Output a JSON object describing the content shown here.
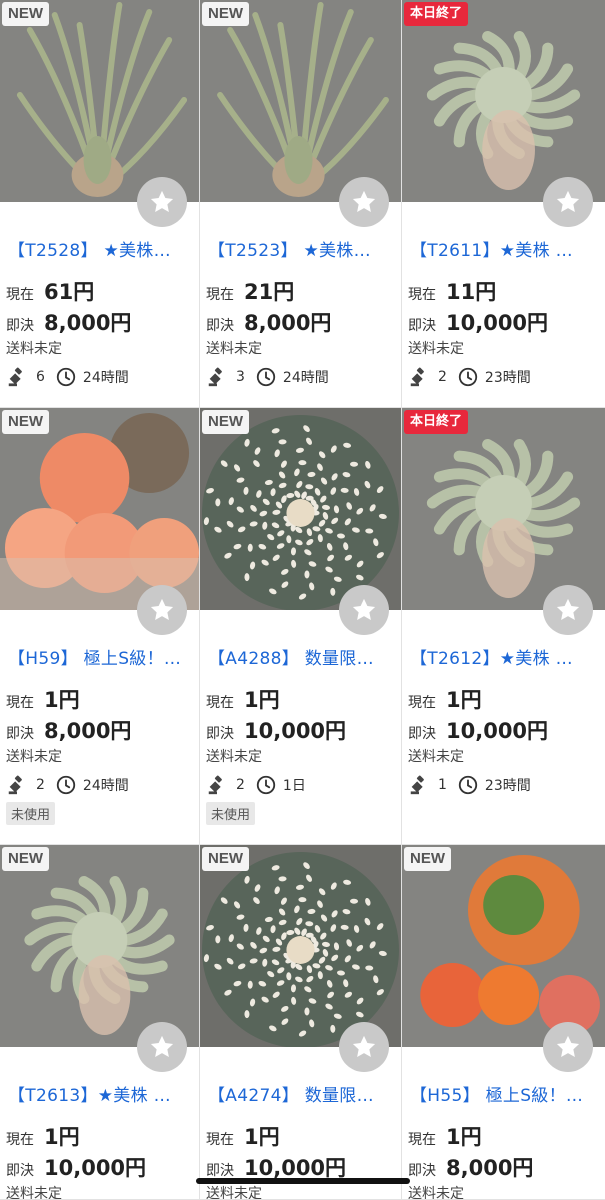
{
  "labels": {
    "current": "現在",
    "buyout": "即決",
    "shipping": "送料未定",
    "new_badge": "NEW",
    "ending_badge": "本日終了",
    "unused": "未使用"
  },
  "items": [
    {
      "badge": "NEW",
      "title": "【T2528】 ★美株…",
      "current": "61円",
      "buyout": "8,000円",
      "shipping": "送料未定",
      "bids": "6",
      "time": "24時間",
      "condition": "",
      "photo": "airplant"
    },
    {
      "badge": "NEW",
      "title": "【T2523】 ★美株…",
      "current": "21円",
      "buyout": "8,000円",
      "shipping": "送料未定",
      "bids": "3",
      "time": "24時間",
      "condition": "",
      "photo": "airplant"
    },
    {
      "badge": "本日終了",
      "title": "【T2611】★美株 …",
      "current": "11円",
      "buyout": "10,000円",
      "shipping": "送料未定",
      "bids": "2",
      "time": "23時間",
      "condition": "",
      "photo": "xerographica"
    },
    {
      "badge": "NEW",
      "title": "【H59】 極上S級！…",
      "current": "1円",
      "buyout": "8,000円",
      "shipping": "送料未定",
      "bids": "2",
      "time": "24時間",
      "condition": "未使用",
      "photo": "cactus-orange"
    },
    {
      "badge": "NEW",
      "title": "【A4288】 数量限…",
      "current": "1円",
      "buyout": "10,000円",
      "shipping": "送料未定",
      "bids": "2",
      "time": "1日",
      "condition": "未使用",
      "photo": "astrophytum"
    },
    {
      "badge": "本日終了",
      "title": "【T2612】★美株 …",
      "current": "1円",
      "buyout": "10,000円",
      "shipping": "送料未定",
      "bids": "1",
      "time": "23時間",
      "condition": "",
      "photo": "xerographica"
    },
    {
      "badge": "NEW",
      "title": "【T2613】★美株 …",
      "current": "1円",
      "buyout": "10,000円",
      "shipping": "送料未定",
      "bids": "",
      "time": "",
      "condition": "",
      "photo": "xerographica"
    },
    {
      "badge": "NEW",
      "title": "【A4274】 数量限…",
      "current": "1円",
      "buyout": "10,000円",
      "shipping": "送料未定",
      "bids": "",
      "time": "",
      "condition": "",
      "photo": "astrophytum"
    },
    {
      "badge": "NEW",
      "title": "【H55】 極上S級！…",
      "current": "1円",
      "buyout": "8,000円",
      "shipping": "送料未定",
      "bids": "",
      "time": "",
      "condition": "",
      "photo": "cactus-mixed"
    }
  ],
  "colors": {
    "link": "#1d67d6",
    "ending_badge": "#e8283c",
    "fav_button": "#c9c9c9"
  }
}
